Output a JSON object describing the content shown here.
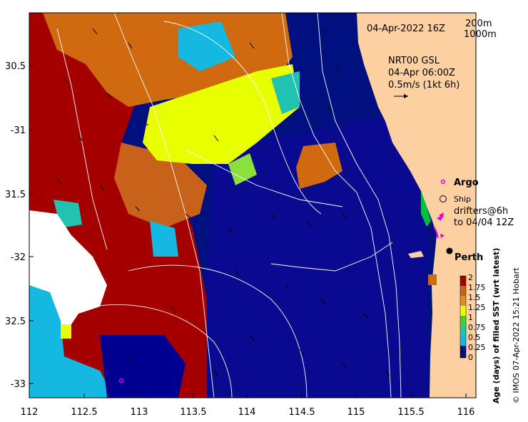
{
  "map": {
    "date_label": "04-Apr-2022 16Z",
    "depth_contours": [
      "200m",
      "1000m"
    ],
    "current_product": "NRT00 GSL",
    "current_time": "04-Apr 06:00Z",
    "current_scale": "0.5m/s (1kt 6h)",
    "legend": {
      "argo": "Argo",
      "ship": "Ship",
      "drifters_line1": "drifters@6h",
      "drifters_line2": "to 04/04 12Z"
    },
    "city": "Perth",
    "x_ticks": [
      "112",
      "112.5",
      "113",
      "113.5",
      "114",
      "114.5",
      "115",
      "115.5",
      "116"
    ],
    "y_ticks": [
      "30.5",
      "-31",
      "31.5",
      "-32",
      "32.5",
      "-33"
    ],
    "colorbar": {
      "title": "Age (days) of filled SST (wrt latest)",
      "ticks": [
        "2",
        "1.75",
        "1.5",
        "1.25",
        "1",
        "0.75",
        "0.5",
        "0.25",
        "0"
      ]
    },
    "credit": "© IMOS 07-Apr-2022 15:21 Hobart",
    "colors": {
      "deep": "#00107e",
      "navy": "#00009a",
      "red": "#a50000",
      "orange": "#d06a10",
      "yellow": "#e8ff00",
      "cyan": "#14b8e0",
      "teal": "#22c2b0",
      "land": "#fdd0a2",
      "argo": "#e000e0"
    }
  }
}
